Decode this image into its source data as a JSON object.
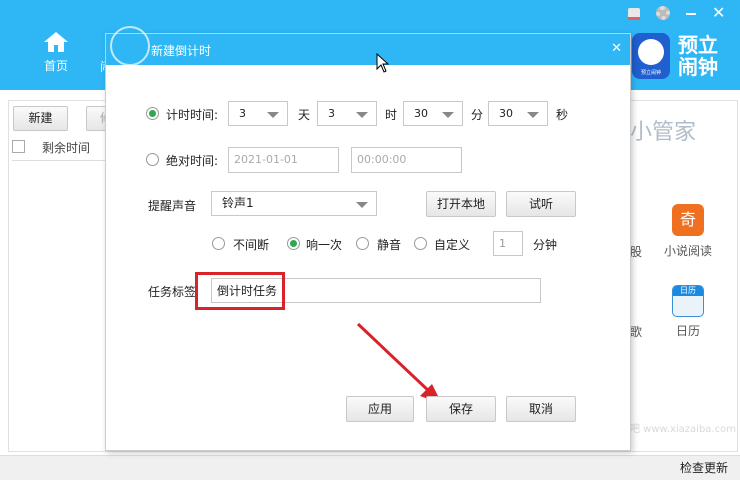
{
  "app": {
    "nav_home": "首页",
    "nav_partial": "闹",
    "logo_text_1": "预立",
    "logo_text_2": "闹钟",
    "logo_icon_caption": "预立闹钟",
    "toolbar_new": "新建",
    "toolbar_partial": "修",
    "col_remaining": "剩余时间",
    "manager_title": "闹小管家",
    "apps": [
      {
        "label": "小说阅读"
      },
      {
        "label": "日历"
      }
    ],
    "partial_app_labels": [
      "选股",
      "歌"
    ],
    "calendar_icon_text": "日历",
    "check_update": "检查更新"
  },
  "dialog": {
    "title": "新建倒计时",
    "countdown_label": "计时时间:",
    "days": "3",
    "days_unit": "天",
    "hours": "3",
    "hours_unit": "时",
    "minutes": "30",
    "minutes_unit": "分",
    "seconds": "30",
    "seconds_unit": "秒",
    "absolute_label": "绝对时间:",
    "absolute_date": "2021-01-01",
    "absolute_time": "00:00:00",
    "sound_label": "提醒声音",
    "sound_value": "铃声1",
    "open_local": "打开本地",
    "preview": "试听",
    "repeat_options": [
      {
        "label": "不间断",
        "checked": false
      },
      {
        "label": "响一次",
        "checked": true
      },
      {
        "label": "静音",
        "checked": false
      },
      {
        "label": "自定义",
        "checked": false
      }
    ],
    "custom_minutes": "1",
    "custom_unit": "分钟",
    "task_label": "任务标签",
    "task_value": "倒计时任务",
    "apply": "应用",
    "save": "保存",
    "cancel": "取消"
  },
  "colors": {
    "header": "#2fb7f5",
    "highlight": "#d9232a",
    "radio_checked": "#2fa84f"
  },
  "watermark": "下载吧 www.xiazaiba.com"
}
